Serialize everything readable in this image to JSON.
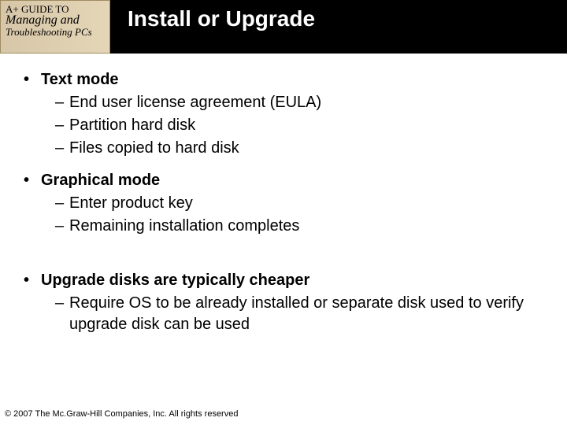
{
  "badge": {
    "line1": "A+ GUIDE TO",
    "line2": "Managing and",
    "line3": "Troubleshooting PCs"
  },
  "title": "Install or Upgrade",
  "bullets": [
    {
      "text": "Text mode",
      "sub": [
        "End user license agreement (EULA)",
        "Partition hard disk",
        "Files copied to hard disk"
      ]
    },
    {
      "text": "Graphical mode",
      "sub": [
        "Enter product key",
        "Remaining installation completes"
      ]
    },
    {
      "text": "Upgrade disks are typically cheaper",
      "sub": [
        "Require OS to be already installed or separate disk used to verify upgrade disk can be used"
      ]
    }
  ],
  "footer": "© 2007 The Mc.Graw-Hill Companies, Inc. All rights reserved"
}
